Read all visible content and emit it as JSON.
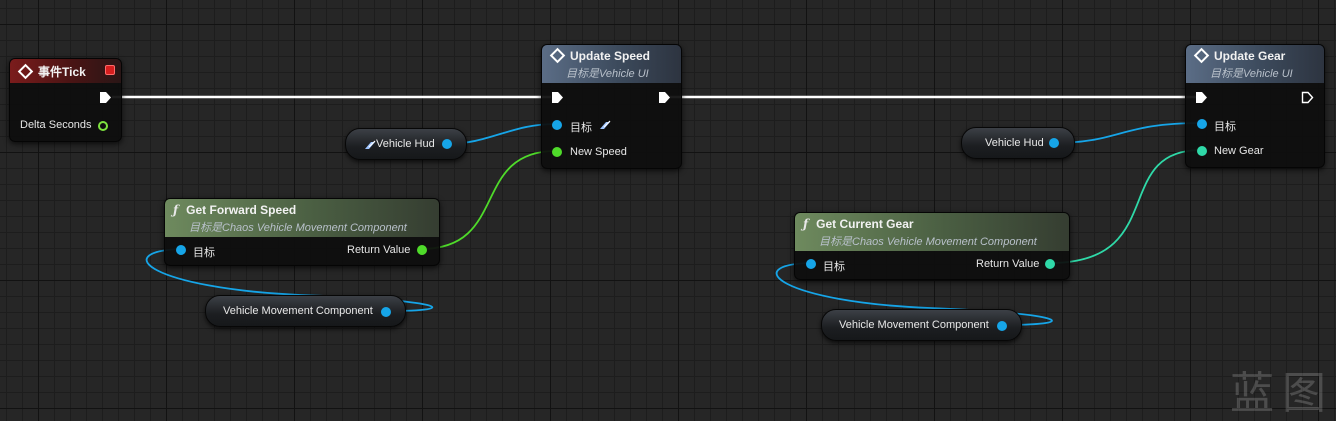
{
  "event_tick": {
    "title": "事件Tick",
    "delta_seconds_label": "Delta Seconds"
  },
  "update_speed": {
    "title": "Update Speed",
    "subtitle": "目标是Vehicle UI",
    "target_label": "目标",
    "new_speed_label": "New Speed"
  },
  "update_gear": {
    "title": "Update Gear",
    "subtitle": "目标是Vehicle UI",
    "target_label": "目标",
    "new_gear_label": "New Gear"
  },
  "get_forward_speed": {
    "title": "Get Forward Speed",
    "subtitle": "目标是Chaos Vehicle Movement Component",
    "target_label": "目标",
    "return_label": "Return Value"
  },
  "get_current_gear": {
    "title": "Get Current Gear",
    "subtitle": "目标是Chaos Vehicle Movement Component",
    "target_label": "目标",
    "return_label": "Return Value"
  },
  "vars": {
    "vehicle_hud_1": "Vehicle Hud",
    "vehicle_hud_2": "Vehicle Hud",
    "vmc_1": "Vehicle Movement Component",
    "vmc_2": "Vehicle Movement Component"
  },
  "watermark": "蓝图",
  "colors": {
    "exec_wire": "#ffffff",
    "object_wire": "#16a5e8",
    "float_wire": "#4fdb2a",
    "int_wire": "#2fd9a8",
    "event_header": "#7b1c1c",
    "function_header": "#5b6d86",
    "pure_header": "#6e8a5e"
  }
}
